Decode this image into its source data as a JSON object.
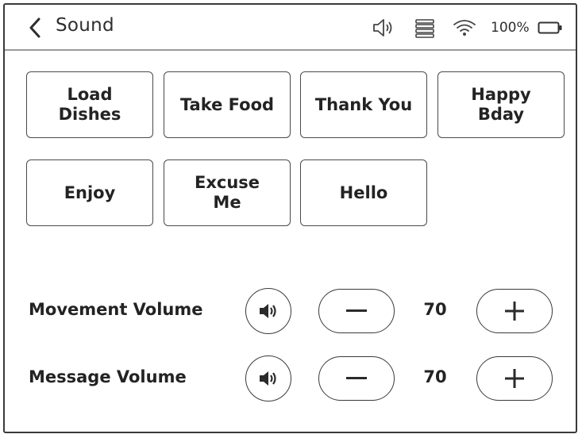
{
  "header": {
    "title": "Sound",
    "battery_text": "100%",
    "icons": [
      "back-chevron-icon",
      "speaker-icon",
      "menu-icon",
      "wifi-icon",
      "battery-icon"
    ]
  },
  "phrases": [
    {
      "label": "Load\nDishes"
    },
    {
      "label": "Take Food"
    },
    {
      "label": "Thank You"
    },
    {
      "label": "Happy\nBday"
    },
    {
      "label": "Enjoy"
    },
    {
      "label": "Excuse\nMe"
    },
    {
      "label": "Hello"
    }
  ],
  "volumes": [
    {
      "label": "Movement Volume",
      "value": "70"
    },
    {
      "label": "Message Volume",
      "value": "70"
    }
  ]
}
